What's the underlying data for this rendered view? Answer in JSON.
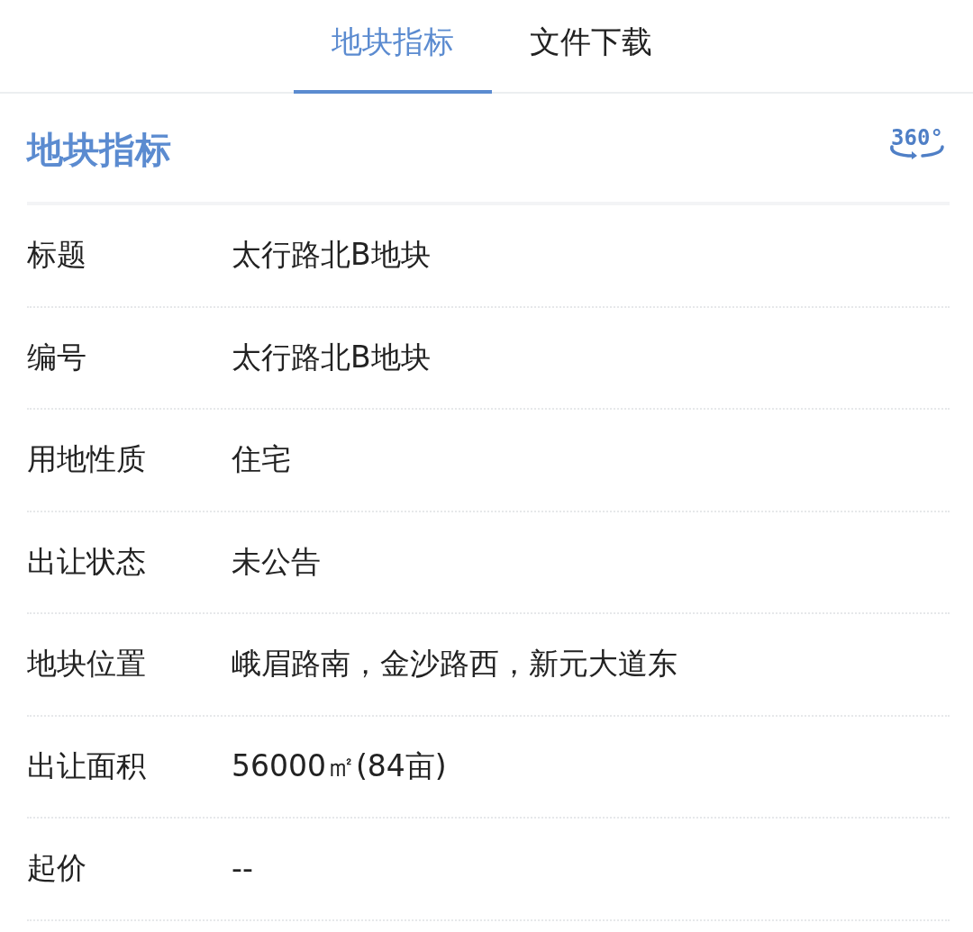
{
  "tabs": [
    {
      "label": "地块指标",
      "selected": true
    },
    {
      "label": "文件下载",
      "selected": false
    }
  ],
  "section": {
    "title": "地块指标",
    "view_button": "360°"
  },
  "fields": [
    {
      "label": "标题",
      "value": "太行路北B地块"
    },
    {
      "label": "编号",
      "value": "太行路北B地块"
    },
    {
      "label": "用地性质",
      "value": "住宅"
    },
    {
      "label": "出让状态",
      "value": "未公告"
    },
    {
      "label": "地块位置",
      "value": "峨眉路南，金沙路西，新元大道东"
    },
    {
      "label": "出让面积",
      "value": "56000㎡(84亩)"
    },
    {
      "label": "起价",
      "value": "--"
    }
  ]
}
